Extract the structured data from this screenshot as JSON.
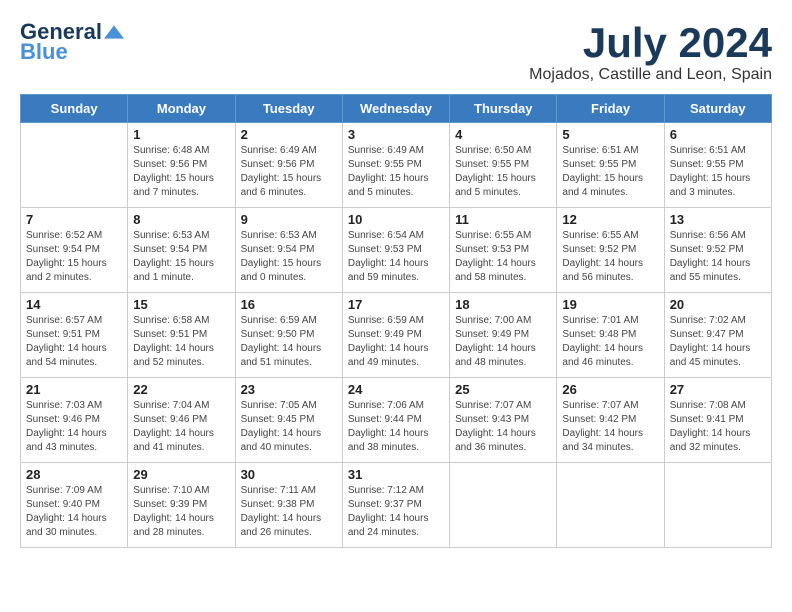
{
  "logo": {
    "line1": "General",
    "line2": "Blue"
  },
  "title": {
    "month_year": "July 2024",
    "location": "Mojados, Castille and Leon, Spain"
  },
  "weekdays": [
    "Sunday",
    "Monday",
    "Tuesday",
    "Wednesday",
    "Thursday",
    "Friday",
    "Saturday"
  ],
  "weeks": [
    [
      {
        "day": "",
        "sunrise": "",
        "sunset": "",
        "daylight": ""
      },
      {
        "day": "1",
        "sunrise": "Sunrise: 6:48 AM",
        "sunset": "Sunset: 9:56 PM",
        "daylight": "Daylight: 15 hours and 7 minutes."
      },
      {
        "day": "2",
        "sunrise": "Sunrise: 6:49 AM",
        "sunset": "Sunset: 9:56 PM",
        "daylight": "Daylight: 15 hours and 6 minutes."
      },
      {
        "day": "3",
        "sunrise": "Sunrise: 6:49 AM",
        "sunset": "Sunset: 9:55 PM",
        "daylight": "Daylight: 15 hours and 5 minutes."
      },
      {
        "day": "4",
        "sunrise": "Sunrise: 6:50 AM",
        "sunset": "Sunset: 9:55 PM",
        "daylight": "Daylight: 15 hours and 5 minutes."
      },
      {
        "day": "5",
        "sunrise": "Sunrise: 6:51 AM",
        "sunset": "Sunset: 9:55 PM",
        "daylight": "Daylight: 15 hours and 4 minutes."
      },
      {
        "day": "6",
        "sunrise": "Sunrise: 6:51 AM",
        "sunset": "Sunset: 9:55 PM",
        "daylight": "Daylight: 15 hours and 3 minutes."
      }
    ],
    [
      {
        "day": "7",
        "sunrise": "Sunrise: 6:52 AM",
        "sunset": "Sunset: 9:54 PM",
        "daylight": "Daylight: 15 hours and 2 minutes."
      },
      {
        "day": "8",
        "sunrise": "Sunrise: 6:53 AM",
        "sunset": "Sunset: 9:54 PM",
        "daylight": "Daylight: 15 hours and 1 minute."
      },
      {
        "day": "9",
        "sunrise": "Sunrise: 6:53 AM",
        "sunset": "Sunset: 9:54 PM",
        "daylight": "Daylight: 15 hours and 0 minutes."
      },
      {
        "day": "10",
        "sunrise": "Sunrise: 6:54 AM",
        "sunset": "Sunset: 9:53 PM",
        "daylight": "Daylight: 14 hours and 59 minutes."
      },
      {
        "day": "11",
        "sunrise": "Sunrise: 6:55 AM",
        "sunset": "Sunset: 9:53 PM",
        "daylight": "Daylight: 14 hours and 58 minutes."
      },
      {
        "day": "12",
        "sunrise": "Sunrise: 6:55 AM",
        "sunset": "Sunset: 9:52 PM",
        "daylight": "Daylight: 14 hours and 56 minutes."
      },
      {
        "day": "13",
        "sunrise": "Sunrise: 6:56 AM",
        "sunset": "Sunset: 9:52 PM",
        "daylight": "Daylight: 14 hours and 55 minutes."
      }
    ],
    [
      {
        "day": "14",
        "sunrise": "Sunrise: 6:57 AM",
        "sunset": "Sunset: 9:51 PM",
        "daylight": "Daylight: 14 hours and 54 minutes."
      },
      {
        "day": "15",
        "sunrise": "Sunrise: 6:58 AM",
        "sunset": "Sunset: 9:51 PM",
        "daylight": "Daylight: 14 hours and 52 minutes."
      },
      {
        "day": "16",
        "sunrise": "Sunrise: 6:59 AM",
        "sunset": "Sunset: 9:50 PM",
        "daylight": "Daylight: 14 hours and 51 minutes."
      },
      {
        "day": "17",
        "sunrise": "Sunrise: 6:59 AM",
        "sunset": "Sunset: 9:49 PM",
        "daylight": "Daylight: 14 hours and 49 minutes."
      },
      {
        "day": "18",
        "sunrise": "Sunrise: 7:00 AM",
        "sunset": "Sunset: 9:49 PM",
        "daylight": "Daylight: 14 hours and 48 minutes."
      },
      {
        "day": "19",
        "sunrise": "Sunrise: 7:01 AM",
        "sunset": "Sunset: 9:48 PM",
        "daylight": "Daylight: 14 hours and 46 minutes."
      },
      {
        "day": "20",
        "sunrise": "Sunrise: 7:02 AM",
        "sunset": "Sunset: 9:47 PM",
        "daylight": "Daylight: 14 hours and 45 minutes."
      }
    ],
    [
      {
        "day": "21",
        "sunrise": "Sunrise: 7:03 AM",
        "sunset": "Sunset: 9:46 PM",
        "daylight": "Daylight: 14 hours and 43 minutes."
      },
      {
        "day": "22",
        "sunrise": "Sunrise: 7:04 AM",
        "sunset": "Sunset: 9:46 PM",
        "daylight": "Daylight: 14 hours and 41 minutes."
      },
      {
        "day": "23",
        "sunrise": "Sunrise: 7:05 AM",
        "sunset": "Sunset: 9:45 PM",
        "daylight": "Daylight: 14 hours and 40 minutes."
      },
      {
        "day": "24",
        "sunrise": "Sunrise: 7:06 AM",
        "sunset": "Sunset: 9:44 PM",
        "daylight": "Daylight: 14 hours and 38 minutes."
      },
      {
        "day": "25",
        "sunrise": "Sunrise: 7:07 AM",
        "sunset": "Sunset: 9:43 PM",
        "daylight": "Daylight: 14 hours and 36 minutes."
      },
      {
        "day": "26",
        "sunrise": "Sunrise: 7:07 AM",
        "sunset": "Sunset: 9:42 PM",
        "daylight": "Daylight: 14 hours and 34 minutes."
      },
      {
        "day": "27",
        "sunrise": "Sunrise: 7:08 AM",
        "sunset": "Sunset: 9:41 PM",
        "daylight": "Daylight: 14 hours and 32 minutes."
      }
    ],
    [
      {
        "day": "28",
        "sunrise": "Sunrise: 7:09 AM",
        "sunset": "Sunset: 9:40 PM",
        "daylight": "Daylight: 14 hours and 30 minutes."
      },
      {
        "day": "29",
        "sunrise": "Sunrise: 7:10 AM",
        "sunset": "Sunset: 9:39 PM",
        "daylight": "Daylight: 14 hours and 28 minutes."
      },
      {
        "day": "30",
        "sunrise": "Sunrise: 7:11 AM",
        "sunset": "Sunset: 9:38 PM",
        "daylight": "Daylight: 14 hours and 26 minutes."
      },
      {
        "day": "31",
        "sunrise": "Sunrise: 7:12 AM",
        "sunset": "Sunset: 9:37 PM",
        "daylight": "Daylight: 14 hours and 24 minutes."
      },
      {
        "day": "",
        "sunrise": "",
        "sunset": "",
        "daylight": ""
      },
      {
        "day": "",
        "sunrise": "",
        "sunset": "",
        "daylight": ""
      },
      {
        "day": "",
        "sunrise": "",
        "sunset": "",
        "daylight": ""
      }
    ]
  ]
}
